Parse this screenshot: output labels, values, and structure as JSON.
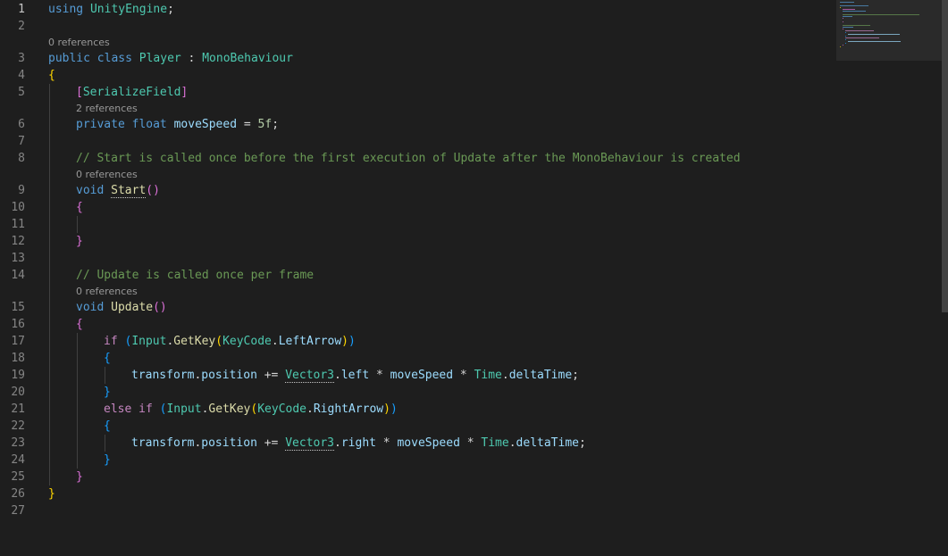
{
  "colors": {
    "background": "#1e1e1e",
    "plain": "#d4d4d4",
    "keyword": "#569cd6",
    "type": "#4ec9b0",
    "method": "#dcdcaa",
    "field": "#9cdcfe",
    "number": "#b5cea8",
    "comment": "#6a9955",
    "control": "#c586c0",
    "brace_gold": "#ffd700",
    "brace_purple": "#da70d6",
    "brace_blue": "#179fff",
    "codelens": "#999999",
    "line_number": "#858585",
    "active_line_number": "#c6c6c6"
  },
  "editor": {
    "active_line": 1,
    "lines": [
      {
        "n": 1,
        "indent": 0,
        "tokens": [
          {
            "t": "using",
            "c": "keyword"
          },
          {
            "t": " "
          },
          {
            "t": "UnityEngine",
            "c": "type"
          },
          {
            "t": ";"
          }
        ]
      },
      {
        "n": 2,
        "indent": 0,
        "tokens": []
      },
      {
        "n": 3,
        "indent": 0,
        "lens": "0 references",
        "tokens": [
          {
            "t": "public",
            "c": "keyword"
          },
          {
            "t": " "
          },
          {
            "t": "class",
            "c": "keyword"
          },
          {
            "t": " "
          },
          {
            "t": "Player",
            "c": "type"
          },
          {
            "t": " : "
          },
          {
            "t": "MonoBehaviour",
            "c": "type"
          }
        ]
      },
      {
        "n": 4,
        "indent": 0,
        "tokens": [
          {
            "t": "{",
            "c": "brace_gold"
          }
        ]
      },
      {
        "n": 5,
        "indent": 1,
        "tokens": [
          {
            "t": "[",
            "c": "brace_purple"
          },
          {
            "t": "SerializeField",
            "c": "type"
          },
          {
            "t": "]",
            "c": "brace_purple"
          }
        ]
      },
      {
        "n": 6,
        "indent": 1,
        "lens": "2 references",
        "tokens": [
          {
            "t": "private",
            "c": "keyword"
          },
          {
            "t": " "
          },
          {
            "t": "float",
            "c": "keyword"
          },
          {
            "t": " "
          },
          {
            "t": "moveSpeed",
            "c": "field"
          },
          {
            "t": " = "
          },
          {
            "t": "5f",
            "c": "number"
          },
          {
            "t": ";"
          }
        ]
      },
      {
        "n": 7,
        "indent": 0,
        "tokens": []
      },
      {
        "n": 8,
        "indent": 1,
        "tokens": [
          {
            "t": "// Start is called once before the first execution of Update after the MonoBehaviour is created",
            "c": "comment"
          }
        ]
      },
      {
        "n": 9,
        "indent": 1,
        "lens": "0 references",
        "tokens": [
          {
            "t": "void",
            "c": "keyword"
          },
          {
            "t": " "
          },
          {
            "t": "Start",
            "c": "method",
            "dotted": true
          },
          {
            "t": "()",
            "c": "brace_purple"
          }
        ]
      },
      {
        "n": 10,
        "indent": 1,
        "tokens": [
          {
            "t": "{",
            "c": "brace_purple"
          }
        ]
      },
      {
        "n": 11,
        "indent": 0,
        "tokens": []
      },
      {
        "n": 12,
        "indent": 1,
        "tokens": [
          {
            "t": "}",
            "c": "brace_purple"
          }
        ]
      },
      {
        "n": 13,
        "indent": 0,
        "tokens": []
      },
      {
        "n": 14,
        "indent": 1,
        "tokens": [
          {
            "t": "// Update is called once per frame",
            "c": "comment"
          }
        ]
      },
      {
        "n": 15,
        "indent": 1,
        "lens": "0 references",
        "tokens": [
          {
            "t": "void",
            "c": "keyword"
          },
          {
            "t": " "
          },
          {
            "t": "Update",
            "c": "method"
          },
          {
            "t": "()",
            "c": "brace_purple"
          }
        ]
      },
      {
        "n": 16,
        "indent": 1,
        "tokens": [
          {
            "t": "{",
            "c": "brace_purple"
          }
        ]
      },
      {
        "n": 17,
        "indent": 2,
        "tokens": [
          {
            "t": "if",
            "c": "control"
          },
          {
            "t": " "
          },
          {
            "t": "(",
            "c": "brace_blue"
          },
          {
            "t": "Input",
            "c": "type"
          },
          {
            "t": "."
          },
          {
            "t": "GetKey",
            "c": "method"
          },
          {
            "t": "(",
            "c": "brace_gold"
          },
          {
            "t": "KeyCode",
            "c": "type"
          },
          {
            "t": "."
          },
          {
            "t": "LeftArrow",
            "c": "field"
          },
          {
            "t": ")",
            "c": "brace_gold"
          },
          {
            "t": ")",
            "c": "brace_blue"
          }
        ]
      },
      {
        "n": 18,
        "indent": 2,
        "tokens": [
          {
            "t": "{",
            "c": "brace_blue"
          }
        ]
      },
      {
        "n": 19,
        "indent": 3,
        "tokens": [
          {
            "t": "transform",
            "c": "field"
          },
          {
            "t": "."
          },
          {
            "t": "position",
            "c": "field"
          },
          {
            "t": " += "
          },
          {
            "t": "Vector3",
            "c": "type",
            "dotted": true
          },
          {
            "t": "."
          },
          {
            "t": "left",
            "c": "field"
          },
          {
            "t": " * "
          },
          {
            "t": "moveSpeed",
            "c": "field"
          },
          {
            "t": " * "
          },
          {
            "t": "Time",
            "c": "type"
          },
          {
            "t": "."
          },
          {
            "t": "deltaTime",
            "c": "field"
          },
          {
            "t": ";"
          }
        ]
      },
      {
        "n": 20,
        "indent": 2,
        "tokens": [
          {
            "t": "}",
            "c": "brace_blue"
          }
        ]
      },
      {
        "n": 21,
        "indent": 2,
        "tokens": [
          {
            "t": "else",
            "c": "control"
          },
          {
            "t": " "
          },
          {
            "t": "if",
            "c": "control"
          },
          {
            "t": " "
          },
          {
            "t": "(",
            "c": "brace_blue"
          },
          {
            "t": "Input",
            "c": "type"
          },
          {
            "t": "."
          },
          {
            "t": "GetKey",
            "c": "method"
          },
          {
            "t": "(",
            "c": "brace_gold"
          },
          {
            "t": "KeyCode",
            "c": "type"
          },
          {
            "t": "."
          },
          {
            "t": "RightArrow",
            "c": "field"
          },
          {
            "t": ")",
            "c": "brace_gold"
          },
          {
            "t": ")",
            "c": "brace_blue"
          }
        ]
      },
      {
        "n": 22,
        "indent": 2,
        "tokens": [
          {
            "t": "{",
            "c": "brace_blue"
          }
        ]
      },
      {
        "n": 23,
        "indent": 3,
        "tokens": [
          {
            "t": "transform",
            "c": "field"
          },
          {
            "t": "."
          },
          {
            "t": "position",
            "c": "field"
          },
          {
            "t": " += "
          },
          {
            "t": "Vector3",
            "c": "type",
            "dotted": true
          },
          {
            "t": "."
          },
          {
            "t": "right",
            "c": "field"
          },
          {
            "t": " * "
          },
          {
            "t": "moveSpeed",
            "c": "field"
          },
          {
            "t": " * "
          },
          {
            "t": "Time",
            "c": "type"
          },
          {
            "t": "."
          },
          {
            "t": "deltaTime",
            "c": "field"
          },
          {
            "t": ";"
          }
        ]
      },
      {
        "n": 24,
        "indent": 2,
        "tokens": [
          {
            "t": "}",
            "c": "brace_blue"
          }
        ]
      },
      {
        "n": 25,
        "indent": 1,
        "tokens": [
          {
            "t": "}",
            "c": "brace_purple"
          }
        ]
      },
      {
        "n": 26,
        "indent": 0,
        "tokens": [
          {
            "t": "}",
            "c": "brace_gold"
          }
        ]
      },
      {
        "n": 27,
        "indent": 0,
        "tokens": []
      }
    ]
  }
}
